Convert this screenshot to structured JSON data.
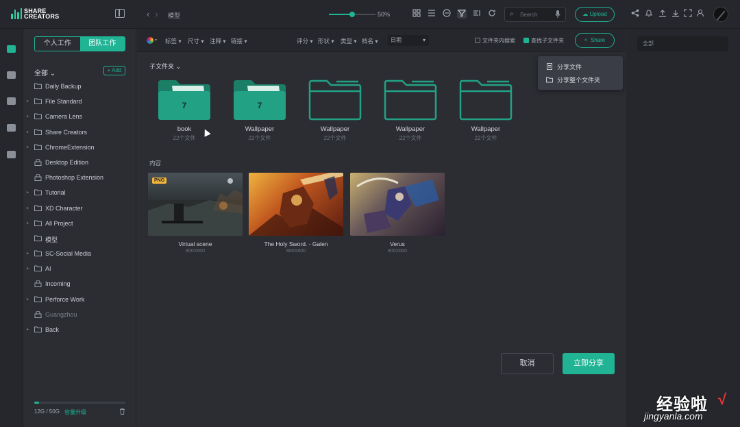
{
  "app": {
    "logo_line1": "SHARE",
    "logo_line2": "CREATORS",
    "accent": "#20b394"
  },
  "topbar": {
    "breadcrumb": "模型",
    "zoom": "50%",
    "search_placeholder": "Search",
    "upload_label": "Upload"
  },
  "sidebar": {
    "tab_personal": "个人工作",
    "tab_team": "团队工作",
    "all_label": "全部",
    "add_label": "+ Add",
    "items": [
      {
        "label": "Daily Backup"
      },
      {
        "label": "File Standard"
      },
      {
        "label": "Camera Lens"
      },
      {
        "label": "Share Creators"
      },
      {
        "label": "ChromeExtension"
      },
      {
        "label": "Desktop Edition"
      },
      {
        "label": "Photoshop Extension"
      },
      {
        "label": "Tutorial"
      },
      {
        "label": "XD Character"
      },
      {
        "label": "All Project"
      },
      {
        "label": "模型"
      },
      {
        "label": "SC-Social Media"
      },
      {
        "label": "AI"
      },
      {
        "label": "Incoming"
      },
      {
        "label": "Perforce Work"
      },
      {
        "label": "Guangzhou"
      },
      {
        "label": "Back"
      }
    ],
    "quota_text": "12G / 50G",
    "quota_fraction": 0.05,
    "upgrade_label": "容量升级"
  },
  "filters": {
    "tags": "标签",
    "size": "尺寸",
    "notes": "注释",
    "link": "链接",
    "date": "日期",
    "rating": "评分",
    "shape": "形状",
    "type": "类型",
    "ext": "档名",
    "search_in_folder": "文件夹内搜索",
    "search_subfolders": "查找子文件夹",
    "share_label": "Share"
  },
  "main": {
    "subfolders_heading": "子文件夹",
    "folders": [
      {
        "name": "book",
        "count": "22个文件",
        "badge": "7"
      },
      {
        "name": "Wallpaper",
        "count": "22个文件",
        "badge": "7"
      },
      {
        "name": "Wallpaper",
        "count": "22个文件",
        "badge": ""
      },
      {
        "name": "Wallpaper",
        "count": "22个文件",
        "badge": ""
      },
      {
        "name": "Wallpaper",
        "count": "22个文件",
        "badge": ""
      }
    ],
    "content_heading": "内容",
    "items": [
      {
        "name": "Virtual scene",
        "size": "800X600",
        "badge": "PNG"
      },
      {
        "name": "The Holy Sword. - Galen",
        "size": "800X600"
      },
      {
        "name": "Verus",
        "size": "800X600"
      }
    ],
    "cancel_label": "取消",
    "confirm_label": "立即分享"
  },
  "dropdown": {
    "share_file": "分享文件",
    "share_folder": "分享整个文件夹"
  },
  "rightpanel": {
    "select_value": "全部"
  },
  "watermark": {
    "cn": "经验啦",
    "check": "√",
    "en": "jingyanla.com"
  }
}
